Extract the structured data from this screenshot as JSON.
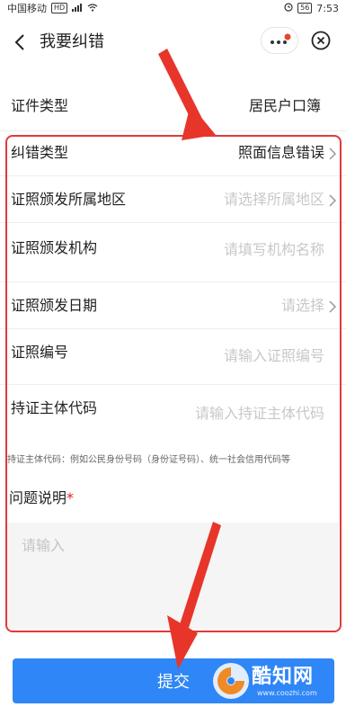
{
  "status_bar": {
    "carrier": "中国移动",
    "carrier_badge": "HD",
    "signal": "4G",
    "battery": "56",
    "time": "7:53"
  },
  "nav": {
    "title": "我要纠错",
    "back_icon": "chevron-left-icon",
    "more_icon": "more-dots-icon",
    "close_icon": "close-circle-icon"
  },
  "form": {
    "rows": [
      {
        "label": "证件类型",
        "value": "居民户口簿",
        "filled": true,
        "chevron": false
      },
      {
        "label": "纠错类型",
        "value": "照面信息错误",
        "filled": true,
        "chevron": true
      },
      {
        "label": "证照颁发所属地区",
        "value": "请选择所属地区",
        "filled": false,
        "chevron": true
      },
      {
        "label": "证照颁发机构",
        "value": "请填写机构名称",
        "filled": false,
        "chevron": false
      },
      {
        "label": "证照颁发日期",
        "value": "请选择",
        "filled": false,
        "chevron": true
      },
      {
        "label": "证照编号",
        "value": "请输入证照编号",
        "filled": false,
        "chevron": false
      },
      {
        "label": "持证主体代码",
        "value": "请输入持证主体代码",
        "filled": false,
        "chevron": false
      }
    ],
    "hint": "持证主体代码：例如公民身份号码（身份证号码）、统一社会信用代码等",
    "description_label": "问题说明",
    "required_mark": "*",
    "description_placeholder": "请输入"
  },
  "submit_label": "提交",
  "watermark": {
    "text": "酷知网",
    "url": "www.coozhi.com"
  },
  "colors": {
    "accent": "#2f86f6",
    "annotation": "#e03a3a",
    "required": "#e02020"
  }
}
